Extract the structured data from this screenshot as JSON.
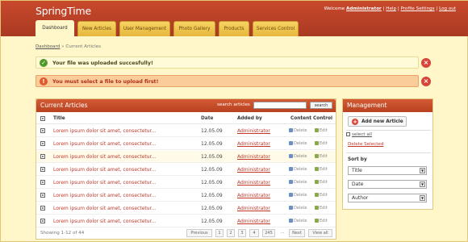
{
  "app": {
    "title": "SpringTime"
  },
  "toplinks": {
    "welcome": "Welcome",
    "user": "Administrator",
    "help": "Help",
    "profile": "Profile Settings",
    "logout": "Log out",
    "sep": "|"
  },
  "tabs": [
    {
      "label": "Dashboard"
    },
    {
      "label": "New Articles"
    },
    {
      "label": "User Management"
    },
    {
      "label": "Photo Gallery"
    },
    {
      "label": "Products"
    },
    {
      "label": "Services Control"
    }
  ],
  "breadcrumb": {
    "root": "Dashboard",
    "sep": "»",
    "current": "Current Articles"
  },
  "messages": {
    "success": "Your file was uploaded succesfully!",
    "error": "You must select a file to upload first!"
  },
  "articles": {
    "title": "Current Articles",
    "search_label": "search articles",
    "search_button": "search",
    "columns": {
      "title": "Title",
      "date": "Date",
      "added_by": "Added by",
      "control": "Content Control"
    },
    "actions": {
      "delete": "Delete",
      "edit": "Edit"
    },
    "rows": [
      {
        "title": "Lorem ipsum dolor sit amet, consectetur...",
        "date": "12.05.09",
        "added_by": "Administrator"
      },
      {
        "title": "Lorem ipsum dolor sit amet, consectetur...",
        "date": "12.05.09",
        "added_by": "Administrator"
      },
      {
        "title": "Lorem ipsum dolor sit amet, consectetur...",
        "date": "12.05.09",
        "added_by": "Administrator"
      },
      {
        "title": "Lorem ipsum dolor sit amet, consectetur...",
        "date": "12.05.09",
        "added_by": "Administrator"
      },
      {
        "title": "Lorem ipsum dolor sit amet, consectetur...",
        "date": "12.05.09",
        "added_by": "Administrator"
      },
      {
        "title": "Lorem ipsum dolor sit amet, consectetur...",
        "date": "12.05.09",
        "added_by": "Administrator"
      },
      {
        "title": "Lorem ipsum dolor sit amet, consectetur...",
        "date": "12.05.09",
        "added_by": "Administrator"
      },
      {
        "title": "Lorem ipsum dolor sit amet, consectetur...",
        "date": "12.05.09",
        "added_by": "Administrator"
      }
    ],
    "footer": {
      "showing": "Showing 1-12 of 44",
      "pages": [
        "Previous",
        "1",
        "2",
        "3",
        "4",
        "245",
        "...",
        "Next",
        "View all"
      ]
    }
  },
  "management": {
    "title": "Management",
    "add_button": "Add new Article",
    "select_all": "select all",
    "delete_selected": "Delete Selected",
    "sort_by": "Sort by",
    "sort_options": [
      "Title",
      "Date",
      "Author"
    ]
  },
  "colors": {
    "header": "#b8421f",
    "tab": "#f2c64c",
    "background": "#fff6c9",
    "link": "#c0392b"
  }
}
